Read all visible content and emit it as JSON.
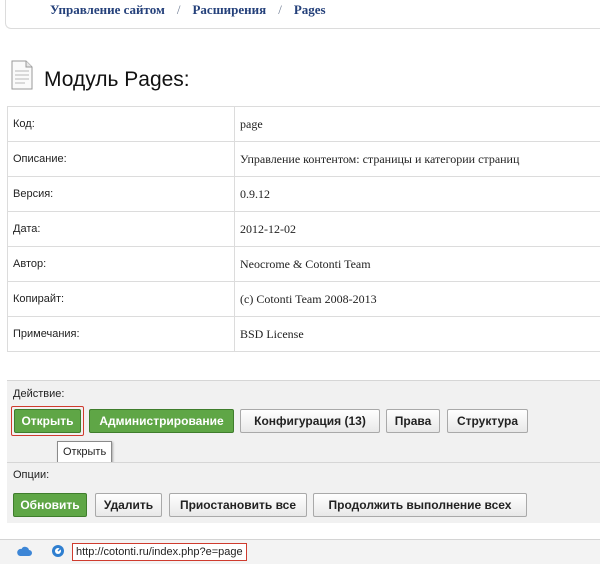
{
  "breadcrumb": [
    "Управление сайтом",
    "Расширения",
    "Pages"
  ],
  "breadcrumb_separator": "/",
  "page": {
    "title": "Модуль Pages:"
  },
  "info": [
    {
      "label": "Код:",
      "value": "page"
    },
    {
      "label": "Описание:",
      "value": "Управление контентом: страницы и категории страниц"
    },
    {
      "label": "Версия:",
      "value": "0.9.12"
    },
    {
      "label": "Дата:",
      "value": "2012-12-02"
    },
    {
      "label": "Автор:",
      "value": "Neocrome & Cotonti Team"
    },
    {
      "label": "Копирайт:",
      "value": "(c) Cotonti Team 2008-2013"
    },
    {
      "label": "Примечания:",
      "value": "BSD License"
    }
  ],
  "actions": {
    "label": "Действие:",
    "buttons": {
      "open": "Открыть",
      "admin": "Администрирование",
      "config": "Конфигурация (13)",
      "rights": "Права",
      "structure": "Структура"
    },
    "tooltip": "Открыть"
  },
  "options": {
    "label": "Опции:",
    "buttons": {
      "update": "Обновить",
      "delete": "Удалить",
      "pause_all": "Приостановить все",
      "resume_all": "Продолжить выполнение всех"
    }
  },
  "status": {
    "url": "http://cotonti.ru/index.php?e=page"
  },
  "colors": {
    "green_button": "#5fa646",
    "highlight_outline": "#cf3b2e",
    "breadcrumb_link": "#24407a"
  }
}
